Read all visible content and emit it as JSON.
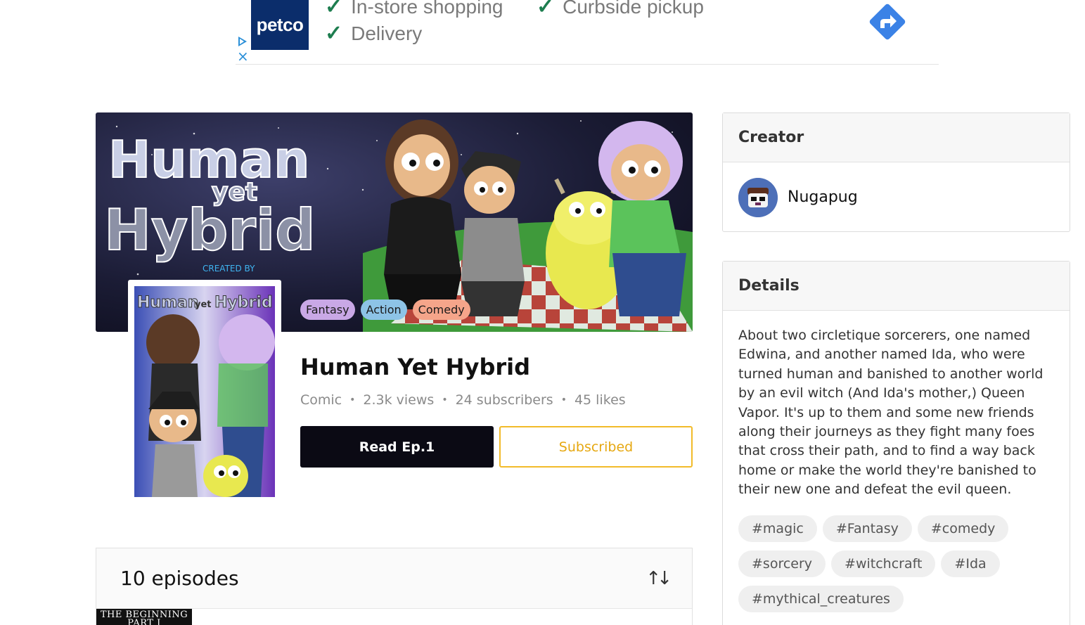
{
  "ad": {
    "brand": "petco",
    "feature1": "In-store shopping",
    "feature2": "Curbside pickup",
    "feature3": "Delivery",
    "close_icon": "×",
    "accent": "#2a8fd8"
  },
  "series": {
    "title": "Human Yet Hybrid",
    "type": "Comic",
    "views": "2.3k views",
    "subscribers": "24 subscribers",
    "likes": "45 likes",
    "banner_title_line1": "Human",
    "banner_title_line2": "yet",
    "banner_title_line3": "Hybrid",
    "banner_credit": "CREATED BY",
    "cover_title_1": "Human",
    "cover_title_2": "yet",
    "cover_title_3": "Hybrid"
  },
  "genres": [
    "Fantasy",
    "Action",
    "Comedy"
  ],
  "actions": {
    "read_label": "Read Ep.1",
    "subscribe_label": "Subscribed"
  },
  "episodes": {
    "count_label": "10 episodes",
    "sort_icon": "sort-icon",
    "first_thumb_text": "THE BEGINNING PART I"
  },
  "creator": {
    "heading": "Creator",
    "name": "Nugapug"
  },
  "details": {
    "heading": "Details",
    "description": "About two circletique sorcerers, one named Edwina, and another named Ida, who were turned human and banished to another world by an evil witch (And Ida's mother,) Queen Vapor. It's up to them and some new friends along their journeys as they fight many foes that cross their path, and to find a way back home or make the world they're banished to their new one and defeat the evil queen.",
    "hashtags": [
      "#magic",
      "#Fantasy",
      "#comedy",
      "#sorcery",
      "#witchcraft",
      "#Ida",
      "#mythical_creatures"
    ]
  }
}
